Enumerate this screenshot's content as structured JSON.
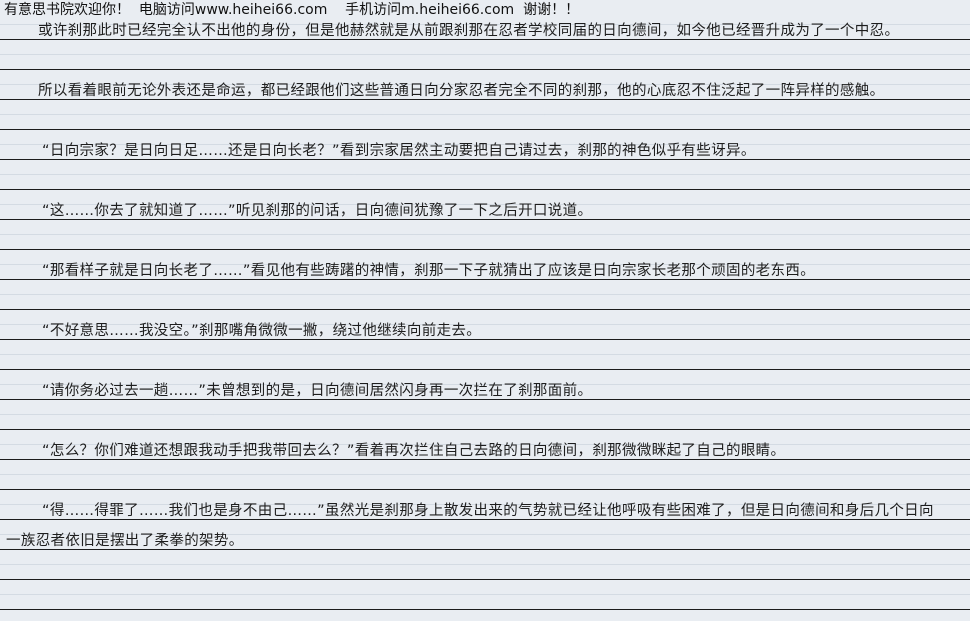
{
  "header": {
    "site_name": "有意思书院欢迎你！",
    "pc_access": "电脑访问www.heihei66.com",
    "mobile_access": "手机访问m.heihei66.com",
    "thanks": "谢谢！！"
  },
  "paragraphs": [
    "或许刹那此时已经完全认不出他的身份，但是他赫然就是从前跟刹那在忍者学校同届的日向德间，如今他已经晋升成为了一个中忍。",
    "所以看着眼前无论外表还是命运，都已经跟他们这些普通日向分家忍者完全不同的刹那，他的心底忍不住泛起了一阵异样的感触。",
    "“日向宗家？是日向日足……还是日向长老？”看到宗家居然主动要把自己请过去，刹那的神色似乎有些讶异。",
    "“这……你去了就知道了……”听见刹那的问话，日向德间犹豫了一下之后开口说道。",
    "“那看样子就是日向长老了……”看见他有些踌躇的神情，刹那一下子就猜出了应该是日向宗家长老那个顽固的老东西。",
    "“不好意思……我没空。”刹那嘴角微微一撇，绕过他继续向前走去。",
    "“请你务必过去一趟……”未曾想到的是，日向德间居然闪身再一次拦在了刹那面前。",
    "“怎么？你们难道还想跟我动手把我带回去么？”看着再次拦住自己去路的日向德间，刹那微微眯起了自己的眼睛。",
    "“得……得罪了……我们也是身不由己……”虽然光是刹那身上散发出来的气势就已经让他呼吸有些困难了，但是日向德间和身后几个日向一族忍者依旧是摆出了柔拳的架势。"
  ]
}
